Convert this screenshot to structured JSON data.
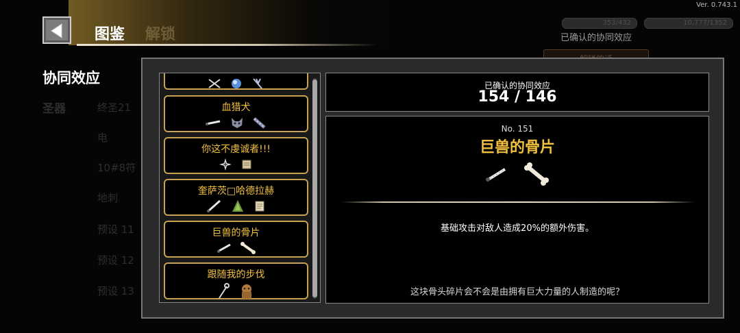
{
  "version": "Ver. 0.743.1",
  "header": {
    "title": "图鉴",
    "faded_tab": "解锁"
  },
  "background": {
    "side_title": "协同效应",
    "categories": [
      "圣器",
      "终圣21",
      "电",
      "10#8符",
      "地刺",
      "预设 11",
      "预设 12",
      "预设 13"
    ],
    "pill_1": "353/432",
    "pill_2": "10,777/1352",
    "confirmed_label": "已确认的协同效应",
    "faded_button": "解锁的话"
  },
  "synergy_list": [
    {
      "name": "",
      "icons": [
        "crossed-blades-icon",
        "blue-orb-icon",
        "dark-claw-icon"
      ]
    },
    {
      "name": "血猎犬",
      "icons": [
        "bone-shard-icon",
        "wolf-head-icon",
        "chain-gauntlet-icon"
      ]
    },
    {
      "name": "你这不虔诚者!!!",
      "icons": [
        "throwing-star-icon",
        "scroll-icon"
      ]
    },
    {
      "name": "奎萨茨□哈德拉赫",
      "icons": [
        "bone-shard-icon",
        "green-cloak-icon",
        "scroll-icon"
      ]
    },
    {
      "name": "巨兽的骨片",
      "icons": [
        "bone-shard-icon",
        "bone-icon"
      ]
    },
    {
      "name": "跟随我的步伐",
      "icons": [
        "staff-icon",
        "brown-bear-icon"
      ]
    }
  ],
  "summary": {
    "label": "已确认的协同效应",
    "count": "154 / 146"
  },
  "detail": {
    "number": "No. 151",
    "title": "巨兽的骨片",
    "icons": [
      "bone-shard-icon",
      "bone-icon"
    ],
    "description": "基础攻击对敌人造成20%的额外伤害。",
    "flavor": "这块骨头碎片会不会是由拥有巨大力量的人制造的呢？"
  }
}
